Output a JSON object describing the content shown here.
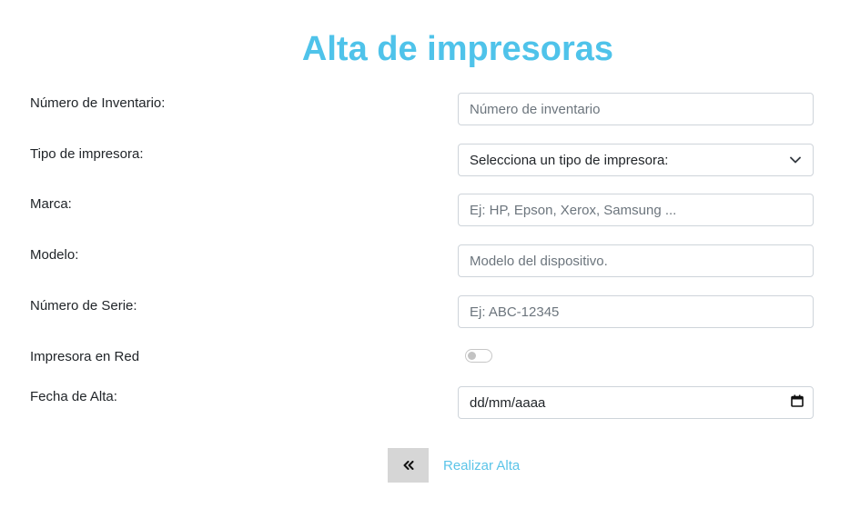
{
  "page": {
    "title": "Alta de impresoras"
  },
  "form": {
    "inventory": {
      "label": "Número de Inventario:",
      "placeholder": "Número de inventario"
    },
    "printer_type": {
      "label": "Tipo de impresora:",
      "selected": "Selecciona un tipo de impresora:"
    },
    "brand": {
      "label": "Marca:",
      "placeholder": "Ej: HP, Epson, Xerox, Samsung ..."
    },
    "model": {
      "label": "Modelo:",
      "placeholder": "Modelo del dispositivo."
    },
    "serial": {
      "label": "Número de Serie:",
      "placeholder": "Ej: ABC-12345"
    },
    "network": {
      "label": "Impresora en Red",
      "checked": false
    },
    "date": {
      "label": "Fecha de Alta:",
      "value": "dd/mm/aaaa"
    }
  },
  "actions": {
    "back_icon": "double-chevron-left-icon",
    "submit_label": "Realizar Alta"
  },
  "colors": {
    "accent": "#4fc3ea",
    "link": "#5bc4e8",
    "back_button_bg": "#d6d6d6",
    "input_border": "#ced4da"
  }
}
